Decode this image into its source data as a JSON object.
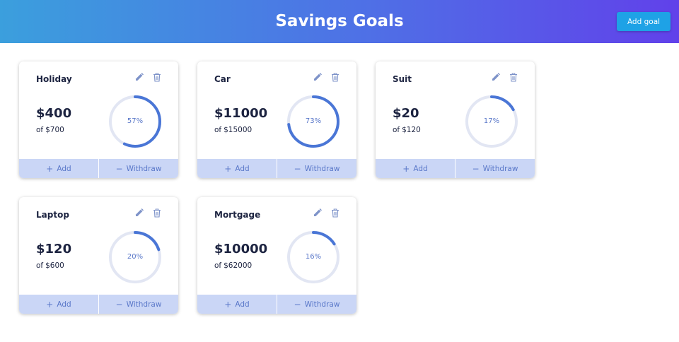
{
  "header": {
    "title": "Savings Goals",
    "add_goal_label": "Add goal"
  },
  "colors": {
    "progress": "#4a76d6",
    "track": "#e2e6f3",
    "footer": "#cad6f6",
    "accent_text": "#5a78c9"
  },
  "goals": [
    {
      "name": "Holiday",
      "amount": "$400",
      "total_prefix": "of",
      "total": "$700",
      "progress_label": "57%",
      "progress": 0.57
    },
    {
      "name": "Car",
      "amount": "$11000",
      "total_prefix": "of",
      "total": "$15000",
      "progress_label": "73%",
      "progress": 0.73
    },
    {
      "name": "Suit",
      "amount": "$20",
      "total_prefix": "of",
      "total": "$120",
      "progress_label": "17%",
      "progress": 0.17
    },
    {
      "name": "Laptop",
      "amount": "$120",
      "total_prefix": "of",
      "total": "$600",
      "progress_label": "20%",
      "progress": 0.2
    },
    {
      "name": "Mortgage",
      "amount": "$10000",
      "total_prefix": "of",
      "total": "$62000",
      "progress_label": "16%",
      "progress": 0.16
    }
  ],
  "actions": {
    "add_symbol": "+",
    "add_label": "Add",
    "withdraw_symbol": "−",
    "withdraw_label": "Withdraw"
  },
  "icons": {
    "edit": "pencil-icon",
    "delete": "trash-icon"
  }
}
